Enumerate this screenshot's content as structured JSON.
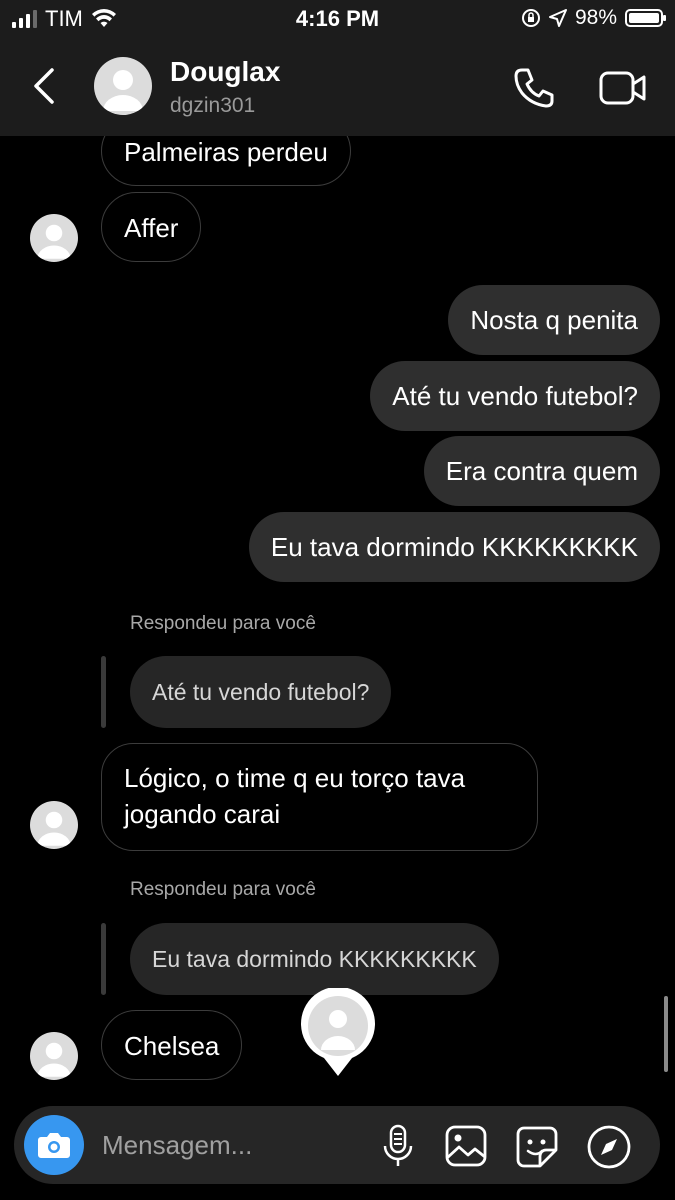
{
  "status_bar": {
    "carrier": "TIM",
    "time": "4:16 PM",
    "battery": "98%"
  },
  "header": {
    "name": "Douglax",
    "username": "dgzin301"
  },
  "messages": {
    "m1": "Palmeiras perdeu",
    "m2": "Affer",
    "m3": "Nosta q penita",
    "m4": "Até tu vendo futebol?",
    "m5": "Era contra quem",
    "m6": "Eu tava dormindo KKKKKKKKK",
    "reply1_label": "Respondeu para você",
    "reply1_quote": "Até tu vendo futebol?",
    "m7": "Lógico, o time q eu torço tava jogando carai",
    "reply2_label": "Respondeu para você",
    "reply2_quote": "Eu tava dormindo KKKKKKKKK",
    "m8": "Chelsea"
  },
  "composer": {
    "placeholder": "Mensagem..."
  },
  "colors": {
    "accent": "#3797f0",
    "outgoing_bubble": "#2f2f2f",
    "header_bg": "#1c1c1c"
  }
}
